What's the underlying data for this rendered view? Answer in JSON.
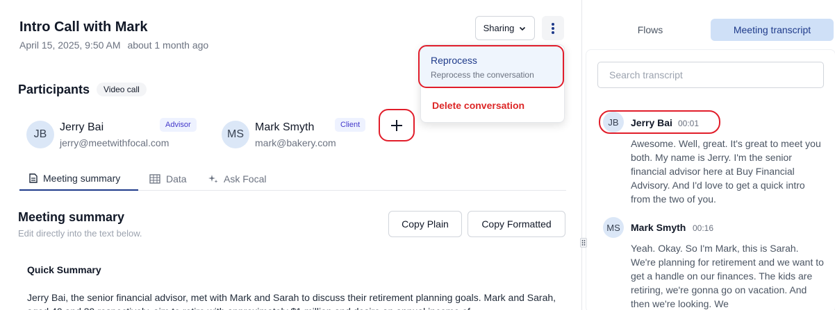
{
  "meeting": {
    "title": "Intro Call with Mark",
    "date": "April 15, 2025, 9:50 AM",
    "relative": "about 1 month ago"
  },
  "toolbar": {
    "sharing_label": "Sharing"
  },
  "menu": {
    "reprocess_label": "Reprocess",
    "reprocess_desc": "Reprocess the conversation",
    "delete_label": "Delete conversation"
  },
  "participants": {
    "label": "Participants",
    "call_type": "Video call",
    "people": [
      {
        "initials": "JB",
        "name": "Jerry Bai",
        "email": "jerry@meetwithfocal.com",
        "role": "Advisor"
      },
      {
        "initials": "MS",
        "name": "Mark Smyth",
        "email": "mark@bakery.com",
        "role": "Client"
      }
    ]
  },
  "tabs": [
    {
      "label": "Meeting summary",
      "icon": "document-icon"
    },
    {
      "label": "Data",
      "icon": "table-icon"
    },
    {
      "label": "Ask Focal",
      "icon": "sparkle-icon"
    }
  ],
  "summary": {
    "title": "Meeting summary",
    "hint": "Edit directly into the text below.",
    "copy_plain": "Copy Plain",
    "copy_formatted": "Copy Formatted",
    "quick_title": "Quick Summary",
    "quick_body": "Jerry Bai, the senior financial advisor, met with Mark and Sarah to discuss their retirement planning goals. Mark and Sarah, aged 40 and 39 respectively, aim to retire with approximately $1 million and desire an annual income of"
  },
  "right_tabs": {
    "flows": "Flows",
    "transcript": "Meeting transcript"
  },
  "transcript": {
    "search_placeholder": "Search transcript",
    "entries": [
      {
        "initials": "JB",
        "name": "Jerry Bai",
        "time": "00:01",
        "text": "Awesome. Well, great. It's great to meet you both. My name is Jerry. I'm the senior financial advisor here at Buy Financial Advisory. And I'd love to get a quick intro from the two of you."
      },
      {
        "initials": "MS",
        "name": "Mark Smyth",
        "time": "00:16",
        "text": "Yeah. Okay. So I'm Mark, this is Sarah. We're planning for retirement and we want to get a handle on our finances. The kids are retiring, we're gonna go on vacation. And then we're looking. We"
      }
    ]
  },
  "colors": {
    "accent": "#1e3a8a",
    "highlight": "#e11d2a",
    "danger": "#dc2626",
    "tab_active_bg": "#cfe0f7"
  }
}
